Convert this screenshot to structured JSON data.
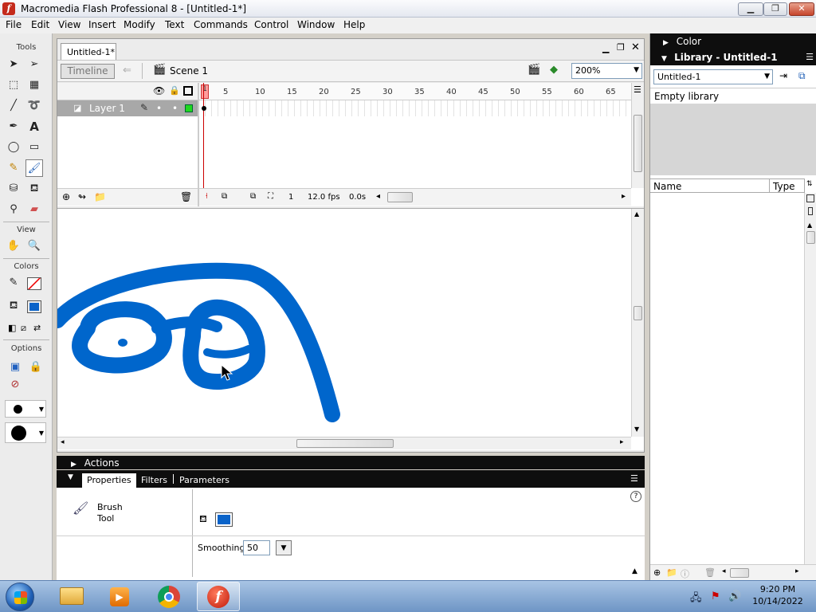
{
  "window": {
    "title": "Macromedia Flash Professional 8 - [Untitled-1*]"
  },
  "menu": [
    "File",
    "Edit",
    "View",
    "Insert",
    "Modify",
    "Text",
    "Commands",
    "Control",
    "Window",
    "Help"
  ],
  "tools": {
    "title": "Tools",
    "view_label": "View",
    "colors_label": "Colors",
    "options_label": "Options"
  },
  "document": {
    "tab": "Untitled-1*",
    "timeline_button": "Timeline",
    "scene": "Scene 1",
    "zoom": "200%",
    "layer_name": "Layer 1",
    "ruler": [
      "5",
      "10",
      "15",
      "20",
      "25",
      "30",
      "35",
      "40",
      "45",
      "50",
      "55",
      "60",
      "65"
    ],
    "frame_marker": "1",
    "status": {
      "frame": "1",
      "fps": "12.0 fps",
      "time": "0.0s"
    }
  },
  "panels": {
    "actions": "Actions",
    "tabs": [
      "Properties",
      "Filters",
      "Parameters"
    ],
    "tool_name": "Brush Tool",
    "tool_name_line1": "Brush",
    "tool_name_line2": "Tool",
    "smoothing_label": "Smoothing",
    "smoothing_value": "50",
    "fill_color": "#0a63c9",
    "stroke_color": "#0066cc"
  },
  "right": {
    "color_panel": "Color",
    "library_panel": "Library - Untitled-1",
    "library_select": "Untitled-1",
    "empty_text": "Empty library",
    "col_name": "Name",
    "col_type": "Type"
  },
  "taskbar": {
    "time": "9:20 PM",
    "date": "10/14/2022"
  }
}
